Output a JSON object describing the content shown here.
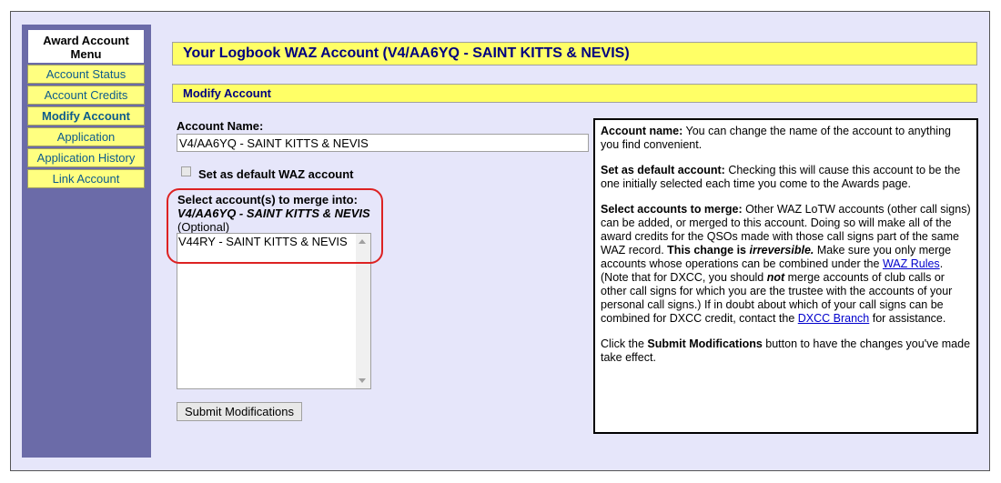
{
  "menu": {
    "title": "Award Account Menu",
    "items": [
      {
        "label": "Account Status",
        "active": false
      },
      {
        "label": "Account Credits",
        "active": false
      },
      {
        "label": "Modify Account",
        "active": true
      },
      {
        "label": "Application",
        "active": false
      },
      {
        "label": "Application History",
        "active": false
      },
      {
        "label": "Link Account",
        "active": false
      }
    ]
  },
  "header": {
    "title": "Your Logbook WAZ Account (V4/AA6YQ - SAINT KITTS & NEVIS)",
    "subtitle": "Modify Account"
  },
  "form": {
    "account_name_label": "Account Name:",
    "account_name_value": "V4/AA6YQ - SAINT KITTS & NEVIS",
    "default_label": "Set as default WAZ account",
    "default_checked": false,
    "merge_label": "Select account(s) to merge into:",
    "merge_target": "V4/AA6YQ - SAINT KITTS & NEVIS",
    "merge_optional": "(Optional)",
    "merge_options": [
      "V44RY - SAINT KITTS & NEVIS"
    ],
    "submit_label": "Submit Modifications"
  },
  "help": {
    "p1_head": "Account name:",
    "p1_text": " You can change the name of the account to anything you find convenient.",
    "p2_head": "Set as default account:",
    "p2_text": " Checking this will cause this account to be the one initially selected each time you come to the Awards page.",
    "p3_head": "Select accounts to merge:",
    "p3_text1": " Other WAZ LoTW accounts (other call signs) can be added, or merged to this account. Doing so will make all of the award credits for the QSOs made with those call signs part of the same WAZ record. ",
    "p3_bold1": "This change is ",
    "p3_bolditalic": "irreversible.",
    "p3_text2": " Make sure you only merge accounts whose operations can be combined under the ",
    "p3_link1": "WAZ Rules",
    "p3_text3": ". (Note that for DXCC, you should ",
    "p3_not": "not",
    "p3_text4": " merge accounts of club calls or other call signs for which you are the trustee with the accounts of your personal call signs.) If in doubt about which of your call signs can be combined for DXCC credit, contact the ",
    "p3_link2": "DXCC Branch",
    "p3_text5": " for assistance.",
    "p4_pre": "Click the ",
    "p4_bold": "Submit Modifications",
    "p4_post": " button to have the changes you've made take effect."
  }
}
